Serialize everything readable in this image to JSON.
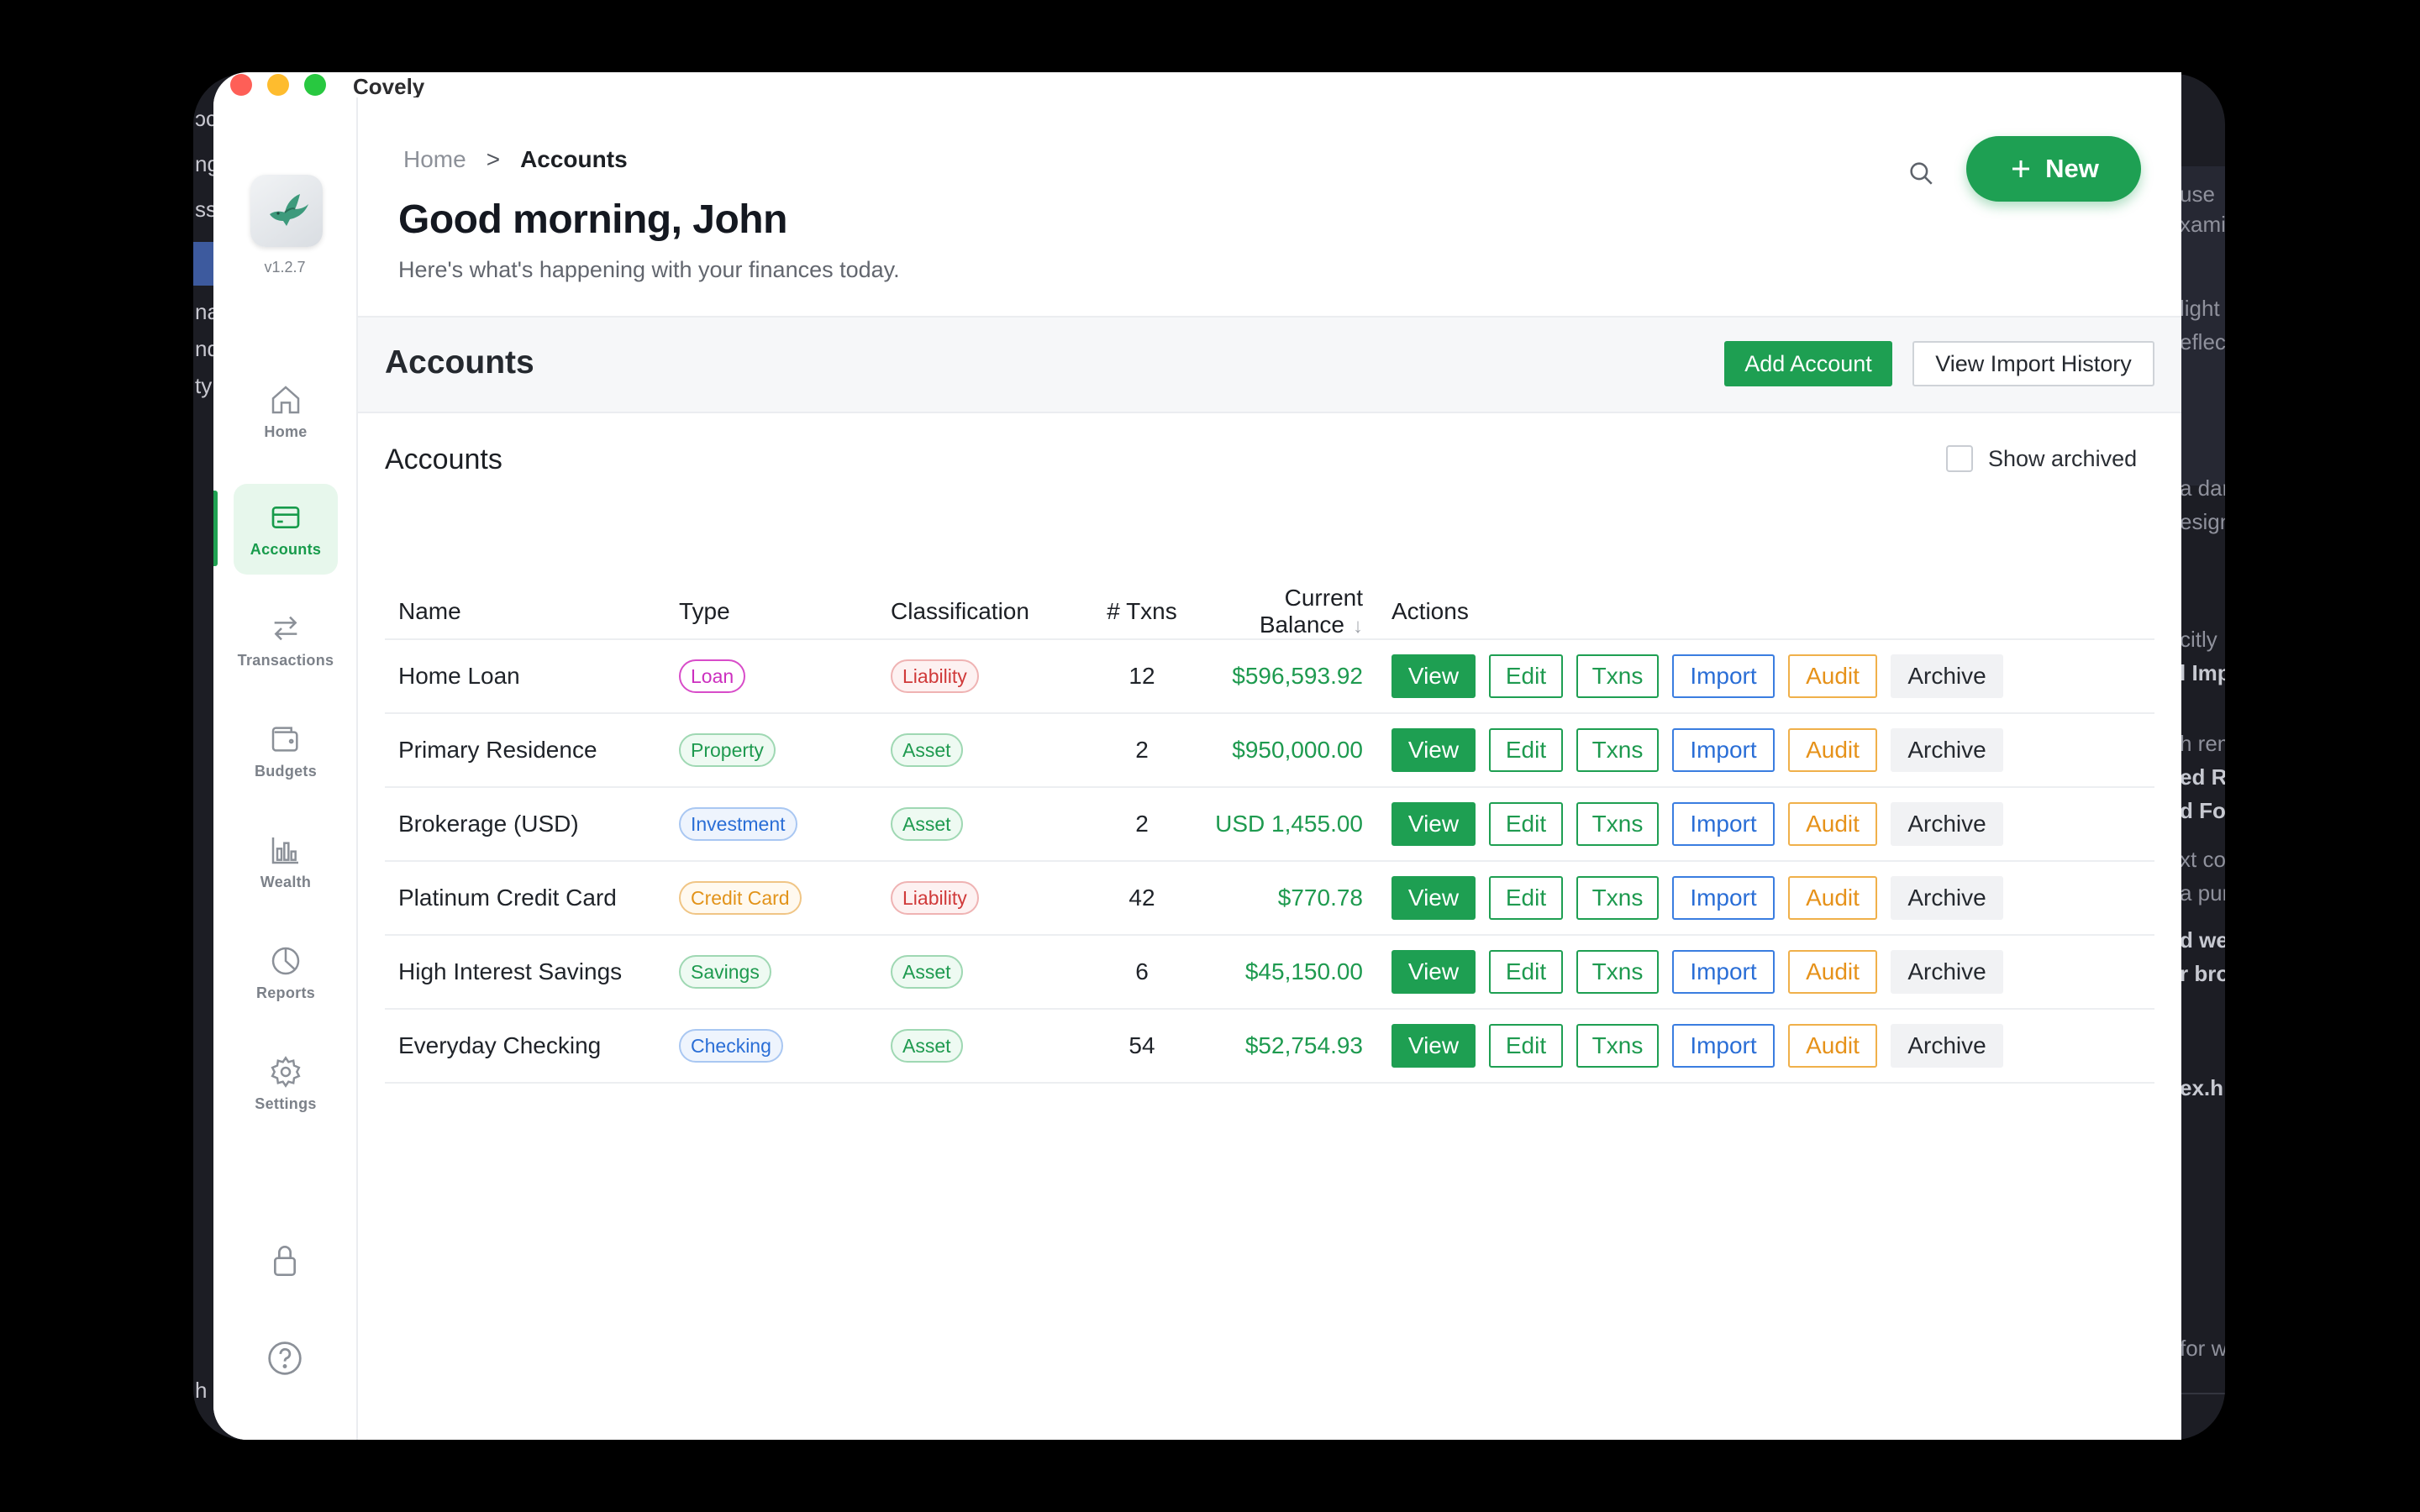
{
  "app": {
    "title": "Covely",
    "version": "v1.2.7"
  },
  "background_window": {
    "left_fragments": [
      "ɔc",
      "ng",
      "ss",
      "nar",
      "nd",
      "ty",
      "h"
    ],
    "right_fragments": [
      "use",
      "xami",
      "light",
      "eflec",
      "a dar",
      "esign",
      "citly",
      "l Imp",
      "h rem",
      "ed R",
      "d For",
      "xt co",
      "a pur",
      "d we",
      "r bro",
      "ex.h",
      "for w"
    ]
  },
  "sidebar": {
    "items": [
      {
        "label": "Home",
        "icon": "home-icon"
      },
      {
        "label": "Accounts",
        "icon": "credit-card-icon",
        "active": true
      },
      {
        "label": "Transactions",
        "icon": "transfer-arrows-icon"
      },
      {
        "label": "Budgets",
        "icon": "wallet-icon"
      },
      {
        "label": "Wealth",
        "icon": "bar-chart-icon"
      },
      {
        "label": "Reports",
        "icon": "pie-chart-icon"
      },
      {
        "label": "Settings",
        "icon": "gear-icon"
      }
    ],
    "bottom_icons": [
      "lock-icon",
      "help-icon"
    ]
  },
  "header": {
    "breadcrumb": {
      "home": "Home",
      "separator": ">",
      "current": "Accounts"
    },
    "greeting": "Good morning, John",
    "subtitle": "Here's what's happening with your finances today.",
    "new_button": "New"
  },
  "section": {
    "title": "Accounts",
    "add_button": "Add Account",
    "history_button": "View Import History"
  },
  "card": {
    "title": "Accounts",
    "show_archived_label": "Show archived",
    "show_archived_checked": false
  },
  "table": {
    "columns": [
      "Name",
      "Type",
      "Classification",
      "# Txns",
      "Current Balance",
      "Actions"
    ],
    "sort_indicator": "↓",
    "action_labels": [
      "View",
      "Edit",
      "Txns",
      "Import",
      "Audit",
      "Archive"
    ],
    "rows": [
      {
        "name": "Home Loan",
        "type": "Loan",
        "classification": "Liability",
        "txns": "12",
        "balance": "$596,593.92"
      },
      {
        "name": "Primary Residence",
        "type": "Property",
        "classification": "Asset",
        "txns": "2",
        "balance": "$950,000.00"
      },
      {
        "name": "Brokerage (USD)",
        "type": "Investment",
        "classification": "Asset",
        "txns": "2",
        "balance": "USD 1,455.00"
      },
      {
        "name": "Platinum Credit Card",
        "type": "Credit Card",
        "classification": "Liability",
        "txns": "42",
        "balance": "$770.78"
      },
      {
        "name": "High Interest Savings",
        "type": "Savings",
        "classification": "Asset",
        "txns": "6",
        "balance": "$45,150.00"
      },
      {
        "name": "Everyday Checking",
        "type": "Checking",
        "classification": "Asset",
        "txns": "54",
        "balance": "$52,754.93"
      }
    ]
  },
  "colors": {
    "accent_green": "#1ea053",
    "link_blue": "#2a6ed6",
    "audit_orange": "#e6921a",
    "liability_red": "#d03a3a",
    "loan_magenta": "#cc2fbf"
  }
}
